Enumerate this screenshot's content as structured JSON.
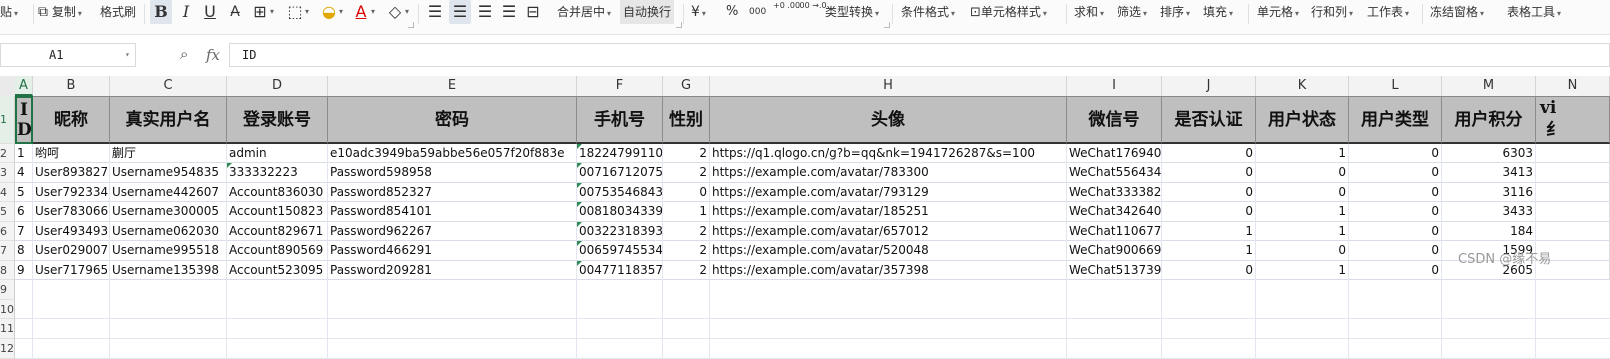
{
  "toolbar": {
    "paste": "贴",
    "copy": "复制",
    "format_painter": "格式刷",
    "merge_center": "合并居中",
    "wrap_text": "自动换行",
    "currency_icon": "¥",
    "percent_icon": "%",
    "thousands_icon": "000",
    "inc_decimal": "+0 .00",
    "dec_decimal": ".00 →.0",
    "type_convert": "类型转换",
    "conditional_format": "条件格式",
    "cell_style": "单元格样式",
    "sum": "求和",
    "filter": "筛选",
    "sort": "排序",
    "fill": "填充",
    "cell": "单元格",
    "row_col": "行和列",
    "worksheet": "工作表",
    "freeze": "冻结窗格",
    "table_tools": "表格工具"
  },
  "formula_bar": {
    "cell_ref": "A1",
    "fx": "fx",
    "content": "ID"
  },
  "columns": [
    "A",
    "B",
    "C",
    "D",
    "E",
    "F",
    "G",
    "H",
    "I",
    "J",
    "K",
    "L",
    "M",
    "N"
  ],
  "selected_column": "A",
  "row_numbers": [
    "1",
    "2",
    "3",
    "4",
    "5",
    "6",
    "7",
    "8",
    "9",
    "10",
    "11",
    "12"
  ],
  "headers": {
    "id_char1": "I",
    "id_char2": "D",
    "cols": [
      "昵称",
      "真实用户名",
      "登录账号",
      "密码",
      "手机号",
      "性别",
      "头像",
      "微信号",
      "是否认证",
      "用户状态",
      "用户类型",
      "用户积分",
      "vi"
    ],
    "n_second_line": "纟"
  },
  "rows": [
    [
      "1",
      "哟呵",
      "蒯厅",
      "admin",
      "e10adc3949ba59abbe56e057f20f883e",
      "18224799110",
      "2",
      "https://q1.qlogo.cn/g?b=qq&nk=1941726287&s=100",
      "WeChat176940",
      "0",
      "1",
      "0",
      "6303"
    ],
    [
      "4",
      "User893827",
      "Username954835",
      "333332223",
      "Password598958",
      "00716712075",
      "2",
      "https://example.com/avatar/783300",
      "WeChat556434",
      "0",
      "0",
      "0",
      "3413"
    ],
    [
      "5",
      "User792334",
      "Username442607",
      "Account836030",
      "Password852327",
      "00753546843",
      "0",
      "https://example.com/avatar/793129",
      "WeChat333382",
      "0",
      "0",
      "0",
      "3116"
    ],
    [
      "6",
      "User783066",
      "Username300005",
      "Account150823",
      "Password854101",
      "00818034339",
      "1",
      "https://example.com/avatar/185251",
      "WeChat342640",
      "0",
      "1",
      "0",
      "3433"
    ],
    [
      "7",
      "User493493",
      "Username062030",
      "Account829671",
      "Password962267",
      "00322318393",
      "2",
      "https://example.com/avatar/657012",
      "WeChat110677",
      "1",
      "1",
      "0",
      "184"
    ],
    [
      "8",
      "User029007",
      "Username995518",
      "Account890569",
      "Password466291",
      "00659745534",
      "2",
      "https://example.com/avatar/520048",
      "WeChat900669",
      "1",
      "0",
      "0",
      "1599"
    ],
    [
      "9",
      "User717965",
      "Username135398",
      "Account523095",
      "Password209281",
      "00477118357",
      "2",
      "https://example.com/avatar/357398",
      "WeChat513739",
      "0",
      "1",
      "0",
      "2605"
    ]
  ],
  "watermark": "CSDN @缘不易"
}
